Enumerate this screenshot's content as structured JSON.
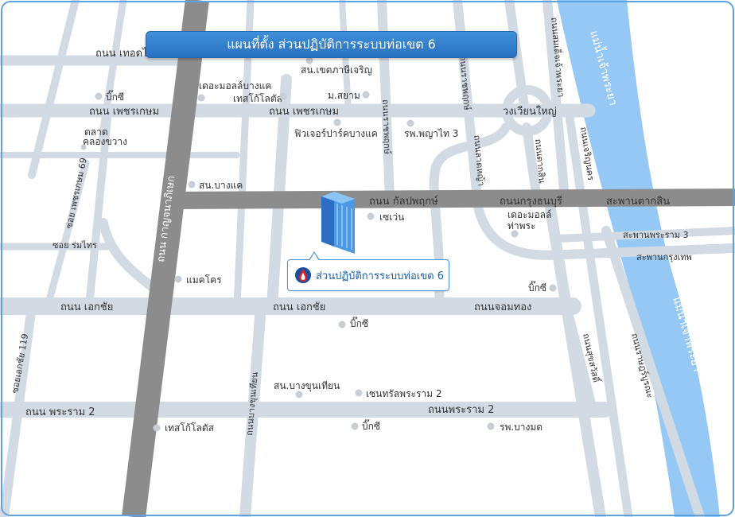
{
  "map": {
    "title": "แผนที่ตั้ง ส่วนปฏิบัติการระบบท่อเขต 6",
    "destination": "ส่วนปฏิบัติการระบบท่อเขต 6",
    "rivers": [
      "แม่น้ำเจ้าพระยา",
      "แม่น้ำเจ้าพระยา"
    ],
    "roads": {
      "kanlapaphruek": "ถนน กัลปพฤกษ์",
      "krungthonburi": "ถนนกรุงธนบุรี",
      "taksin_bridge": "สะพานตากสิน",
      "ekkachai_left": "ถนน เอกชัย",
      "ekkachai_mid": "ถนน เอกชัย",
      "chomthong": "ถนนจอมทอง",
      "rama2_left": "ถนน พระราม 2",
      "rama2_right": "ถนนพระราม 2",
      "phetkasem_left": "ถนน เพชรเกษม",
      "phetkasem_mid": "ถนน เพชรเกษม",
      "kanchanaphisek": "ถนน กาญจนาภิเษก",
      "roundabout": "วงเวียนใหญ่",
      "rama3_bridge": "สะพานพระราม 3",
      "krungthep_bridge": "สะพานกรุงเทพ",
      "top_left_road": "ถนน เทอดไท",
      "ratchaphruek": "ถนนราชพฤกษ์",
      "ratchaphruek2": "ถนนราชพฤกษ์",
      "charoen_nakhon": "ถนนเจริญนคร",
      "lat_ya": "ถนนลาดหญ้า",
      "somdet": "ถนนสมเด็จเจ้าพระยา",
      "tak_sin": "ถนนตากสิน",
      "suk_sawat": "ถนนสุขสวัสดิ์",
      "ratburana": "ถนนราษฎร์บูรณะ",
      "bang_khun_thian": "ถนนบางขุนเทียน",
      "soi_phetkasem69": "ซอย เพชรเกษม 69",
      "soi_romsai": "ซอย ร่มไทร",
      "soi_ekkachai119": "ซอยเอกชัย 119"
    },
    "places": {
      "bigc_1": "บิ๊กซี",
      "talat_khlong_khwang_1": "ตลาด",
      "talat_khlong_khwang_2": "คลองขวาง",
      "the_mall_bangkhae": "เดอะมอลล์บางแค",
      "tesco_1": "เทสโก้โลตัส",
      "police_phasi": "สน.เขตภาษีเจริญ",
      "siam_univ": "ม.สยาม",
      "future_park": "ฟิวเจอร์ปาร์คบางแค",
      "phyathai3": "รพ.พญาไท 3",
      "police_bangkhae": "สน.บางแค",
      "seven_eleven": "เซเว่น",
      "the_mall_thapra_1": "เดอะมอลล์",
      "the_mall_thapra_2": "ท่าพระ",
      "makro": "แมคโคร",
      "bigc_2": "บิ๊กซี",
      "bigc_3": "บิ๊กซี",
      "police_bangkhunthian": "สน.บางขุนเทียน",
      "central_rama2": "เซนทรัลพระราม 2",
      "tesco_2": "เทสโก้โลตัส",
      "bigc_4": "บิ๊กซี",
      "bangmod_hospital": "รพ.บางมด"
    },
    "colors": {
      "minor_road": "#d2dae3",
      "major_road": "#8c8c8c",
      "river": "#96c8f5",
      "frame": "#5aa3e0",
      "banner": "#3580cd",
      "poi_dot": "#c8ced6"
    }
  }
}
